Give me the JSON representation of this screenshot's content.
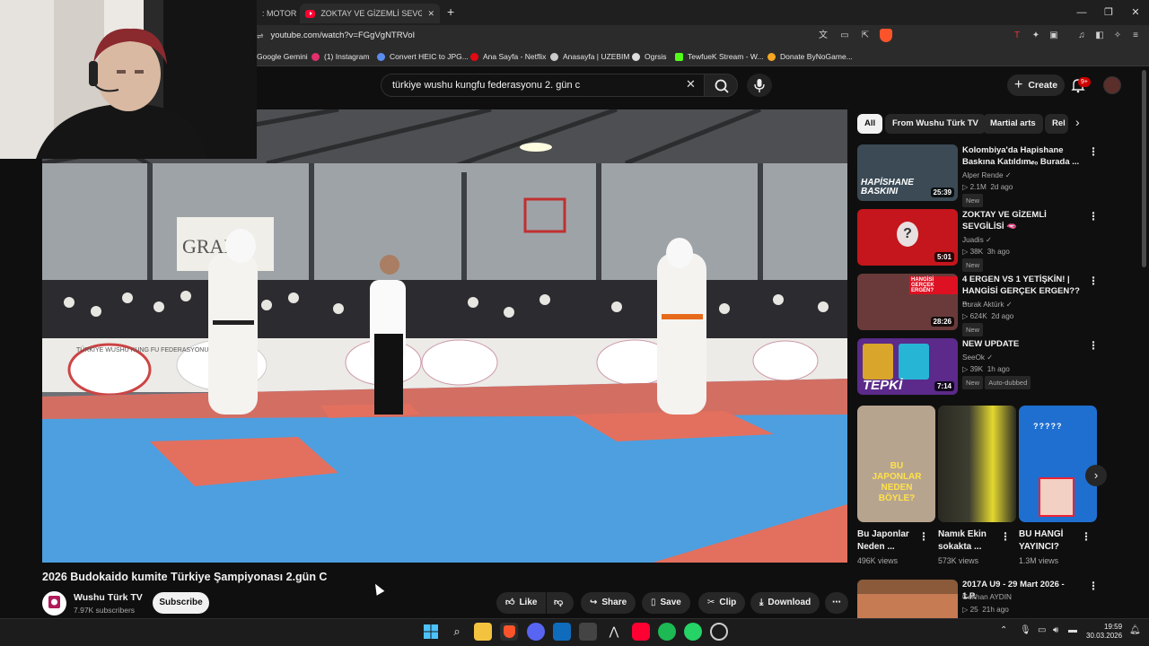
{
  "browser": {
    "tabs": [
      {
        "label": ": MOTOR"
      },
      {
        "label": "ZOKTAY VE GİZEMLİ SEVGİLİSİ 🫦 - Y"
      }
    ],
    "url": "youtube.com/watch?v=FGgVgNTRVoI",
    "bookmarks": [
      {
        "label": "Google Gemini",
        "color": "#4c8df6"
      },
      {
        "label": "(1) Instagram",
        "color": "#e1306c"
      },
      {
        "label": "Convert HEIC to JPG...",
        "color": "#5b8def"
      },
      {
        "label": "Ana Sayfa - Netflix",
        "color": "#e50914"
      },
      {
        "label": "Anasayfa | UZEBIM",
        "color": "#cccccc"
      },
      {
        "label": "Ogrsis",
        "color": "#dddddd"
      },
      {
        "label": "TewfueK Stream - W...",
        "color": "#53fc18"
      },
      {
        "label": "Donate ByNoGame...",
        "color": "#f5a623"
      }
    ]
  },
  "header": {
    "search_value": "türkiye wushu kungfu federasyonu 2. gün c",
    "create_label": "Create",
    "notif_count": "9+"
  },
  "video": {
    "title": "2026 Budokaido kumite Türkiye Şampiyonası 2.gün C",
    "channel": "Wushu Türk TV",
    "subscribers": "7.97K subscribers",
    "subscribe_label": "Subscribe",
    "actions": {
      "like": "Like",
      "share": "Share",
      "save": "Save",
      "clip": "Clip",
      "download": "Download"
    },
    "scene_text": {
      "banner": "TÜRKİYE WUSHU KUNG FU FEDERASYONU",
      "sign": "GRAND"
    }
  },
  "chips": [
    "All",
    "From Wushu Türk TV",
    "Martial arts",
    "Rel"
  ],
  "recommendations": [
    {
      "title": "Kolombiya'da Hapishane Baskına Katıldım𝒸ₒ Burada ...",
      "channel": "Alper Rende",
      "views": "2.1M",
      "age": "2d ago",
      "badge": "New",
      "duration": "25:39",
      "thumb_text": "HAPİSHANE BASKINI",
      "bg": "#3b4a55"
    },
    {
      "title": "ZOKTAY VE GİZEMLİ SEVGİLİSİ 🫦",
      "channel": "Juadis",
      "views": "38K",
      "age": "3h ago",
      "badge": "New",
      "duration": "5:01",
      "thumb_text": "?",
      "bg": "#c4161c"
    },
    {
      "title": "4 ERGEN VS 1 YETİŞKİN! | HANGİSİ GERÇEK ERGEN?? ...",
      "channel": "Burak Aktürk",
      "views": "624K",
      "age": "2d ago",
      "badge": "New",
      "duration": "28:26",
      "thumb_text": "HANGİSİ GERÇEK ERGEN?",
      "bg": "#6a3a3a"
    },
    {
      "title": "NEW UPDATE",
      "channel": "SeeOk",
      "views": "39K",
      "age": "1h ago",
      "badge": "New",
      "extra": "Auto-dubbed",
      "duration": "7:14",
      "thumb_text": "TEPKİ",
      "bg": "#5b2a8a"
    }
  ],
  "shorts": [
    {
      "title": "Bu Japonlar Neden ...",
      "views": "496K views",
      "thumb_text": "BU JAPONLAR NEDEN BÖYLE?",
      "bg": "#b7a48f"
    },
    {
      "title": "Namık Ekin sokakta ...",
      "views": "573K views",
      "thumb_text": "",
      "bg": "#3a3a2c"
    },
    {
      "title": "BU HANGİ YAYINCI?",
      "views": "1.3M views",
      "thumb_text": "?????",
      "bg": "#1f6fd1"
    }
  ],
  "last_rec": {
    "title": "2017A U9 - 29 Mart 2026 - 1.P.",
    "channel": "Gokhan AYDIN",
    "views": "25",
    "age": "21h ago"
  },
  "clock": {
    "time": "19:59",
    "date": "30.03.2026"
  }
}
